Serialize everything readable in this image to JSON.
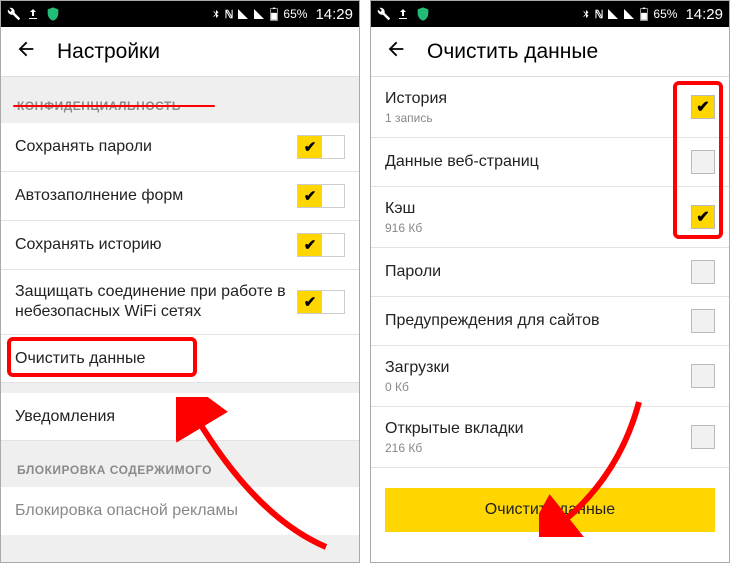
{
  "status_bar": {
    "time": "14:29",
    "battery": "65%"
  },
  "left": {
    "header_title": "Настройки",
    "section_privacy": "КОНФИДЕНЦИАЛЬНОСТЬ",
    "section_block": "БЛОКИРОВКА СОДЕРЖИМОГО",
    "rows": {
      "save_passwords": "Сохранять пароли",
      "autofill": "Автозаполнение форм",
      "save_history": "Сохранять историю",
      "protect_wifi": "Защищать соединение при работе в небезопасных WiFi сетях",
      "clear_data": "Очистить данные",
      "notifications": "Уведомления",
      "block_ads": "Блокировка опасной рекламы"
    }
  },
  "right": {
    "header_title": "Очистить данные",
    "rows": {
      "history": {
        "label": "История",
        "sub": "1 запись"
      },
      "webdata": {
        "label": "Данные веб-страниц"
      },
      "cache": {
        "label": "Кэш",
        "sub": "916 Кб"
      },
      "passwords": {
        "label": "Пароли"
      },
      "warnings": {
        "label": "Предупреждения для сайтов"
      },
      "downloads": {
        "label": "Загрузки",
        "sub": "0 Кб"
      },
      "tabs": {
        "label": "Открытые вкладки",
        "sub": "216 Кб"
      }
    },
    "clear_button": "Очистить данные"
  }
}
